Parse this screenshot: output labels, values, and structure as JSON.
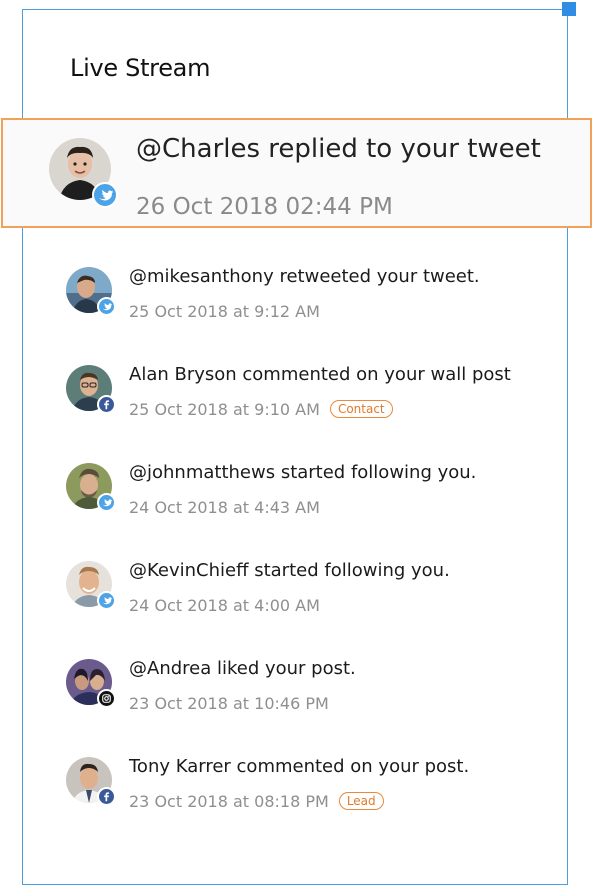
{
  "panel": {
    "title": "Live Stream"
  },
  "highlighted_item": {
    "text": "@Charles replied to your tweet",
    "time": "26 Oct 2018 02:44 PM",
    "network": "twitter"
  },
  "items": [
    {
      "text": "@mikesanthony retweeted your tweet.",
      "time": "25 Oct 2018 at 9:12 AM",
      "network": "twitter",
      "tag": ""
    },
    {
      "text": "Alan Bryson commented on your wall post",
      "time": "25 Oct 2018 at 9:10 AM",
      "network": "facebook",
      "tag": "Contact"
    },
    {
      "text": "@johnmatthews started following you.",
      "time": "24 Oct 2018 at 4:43 AM",
      "network": "twitter",
      "tag": ""
    },
    {
      "text": "@KevinChieff started following you.",
      "time": "24 Oct 2018 at 4:00 AM",
      "network": "twitter",
      "tag": ""
    },
    {
      "text": "@Andrea liked your post.",
      "time": "23 Oct 2018 at 10:46 PM",
      "network": "instagram",
      "tag": ""
    },
    {
      "text": "Tony Karrer commented on your post.",
      "time": "23 Oct 2018 at 08:18 PM",
      "network": "facebook",
      "tag": "Lead"
    }
  ],
  "colors": {
    "frame_border": "#4a9fe0",
    "highlight_border": "#f0a25a",
    "tag_color": "#e07a2a",
    "twitter": "#4da3e8",
    "facebook": "#3b5998",
    "instagram": "#111111"
  }
}
